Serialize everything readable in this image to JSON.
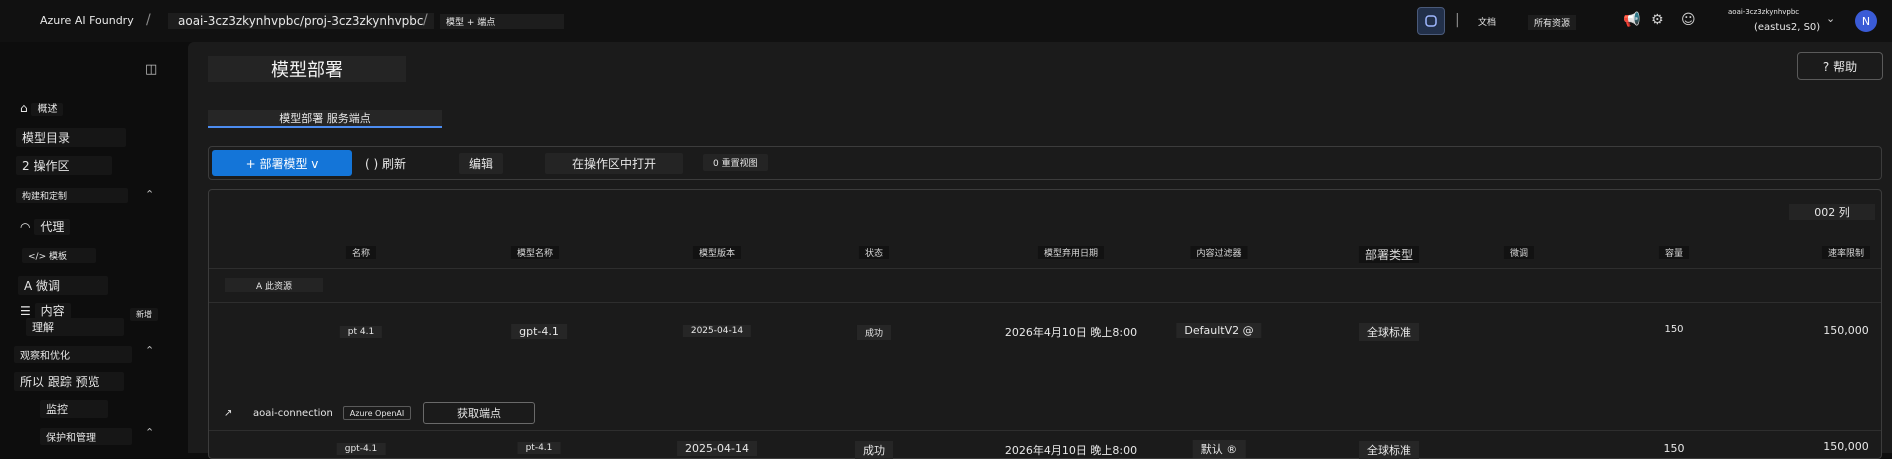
{
  "header": {
    "brand": "Azure AI Foundry",
    "breadcrumb_project": "aoai-3cz3zkynhvpbc/proj-3cz3zkynhvpbc",
    "breadcrumb_page": "模型 + 端点",
    "docs": "文档",
    "all_resources": "所有资源",
    "account_name": "aoai-3cz3zkynhvpbc",
    "account_region": "(eastus2, S0)",
    "avatar_initial": "N"
  },
  "sidebar": {
    "items": [
      {
        "label": "概述"
      },
      {
        "label": "模型目录"
      },
      {
        "label": "2 操作区"
      },
      {
        "label": "构建和定制"
      },
      {
        "label": "代理"
      },
      {
        "label": "</> 模板"
      },
      {
        "label": "A 微调"
      },
      {
        "label": "内容"
      },
      {
        "label": "理解"
      },
      {
        "label": "新增"
      },
      {
        "label": "观察和优化"
      },
      {
        "label": "所以 跟踪 预览"
      },
      {
        "label": "监控"
      },
      {
        "label": "保护和管理"
      }
    ]
  },
  "page": {
    "title": "模型部署",
    "help": "? 帮助",
    "tabs_label": "模型部署 服务端点"
  },
  "toolbar": {
    "deploy": "+ 部署模型 v",
    "refresh": "( ) 刷新",
    "edit": "编辑",
    "open_playground": "在操作区中打开",
    "reset_view": "0 重置视图"
  },
  "grid": {
    "columns_button": "002 列",
    "headers": [
      "名称",
      "模型名称",
      "模型版本",
      "状态",
      "模型弃用日期",
      "内容过滤器",
      "部署类型",
      "微调",
      "容量",
      "速率限制"
    ],
    "group_label": "A 此资源",
    "rows": [
      {
        "name": "pt 4.1",
        "model": "gpt-4.1",
        "version": "2025-04-14",
        "status": "成功",
        "retire": "2026年4月10日 晚上8:00",
        "filter": "DefaultV2 @",
        "type": "全球标准",
        "capacity": "150",
        "rate": "150,000"
      },
      {
        "name": "gpt-4.1",
        "model": "pt-4.1",
        "version": "2025-04-14",
        "status": "成功",
        "retire": "2026年4月10日 晚上8:00",
        "filter": "默认 ®",
        "type": "全球标准",
        "capacity": "150",
        "rate": "150,000"
      }
    ],
    "connection": {
      "name": "aoai-connection",
      "tag": "Azure OpenAI",
      "get_endpoint": "获取端点"
    }
  }
}
